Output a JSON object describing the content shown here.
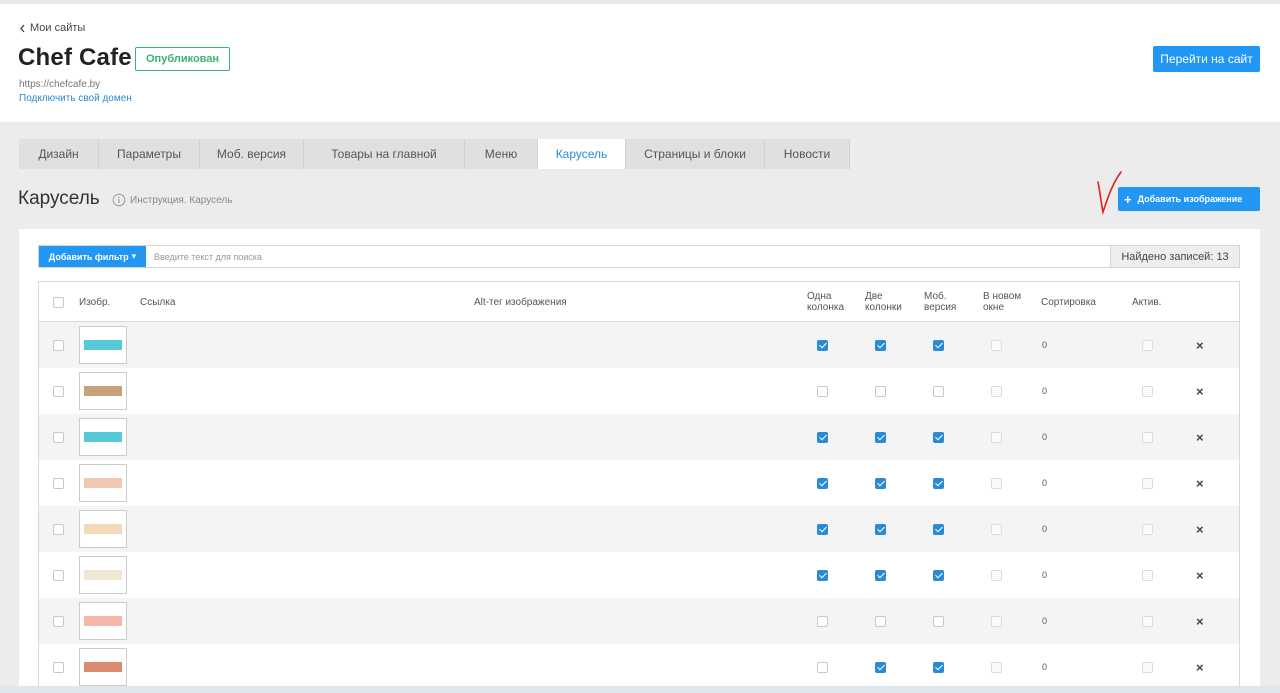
{
  "header": {
    "back_label": "Мои сайты",
    "site_title": "Chef Cafe",
    "status_badge": "Опубликован",
    "site_url": "https://chefcafe.by",
    "connect_domain": "Подключить свой домен",
    "goto_site": "Перейти на сайт"
  },
  "tabs": [
    {
      "label": "Дизайн"
    },
    {
      "label": "Параметры"
    },
    {
      "label": "Моб. версия"
    },
    {
      "label": "Товары на главной"
    },
    {
      "label": "Меню"
    },
    {
      "label": "Карусель"
    },
    {
      "label": "Страницы и блоки"
    },
    {
      "label": "Новости"
    }
  ],
  "section": {
    "title": "Карусель",
    "help_text": "Инструкция. Карусель",
    "add_image": "Добавить изображение"
  },
  "filter": {
    "add_filter": "Добавить фильтр",
    "search_placeholder": "Введите текст для поиска",
    "found": "Найдено записей: 13"
  },
  "columns": {
    "image": "Изобр.",
    "link": "Ссылка",
    "alt": "Alt-тег изображения",
    "one_col_1": "Одна",
    "one_col_2": "колонка",
    "two_col_1": "Две",
    "two_col_2": "колонки",
    "mob_1": "Моб.",
    "mob_2": "версия",
    "new_win_1": "В новом",
    "new_win_2": "окне",
    "sort": "Сортировка",
    "active": "Актив."
  },
  "rows": [
    {
      "thumb_color": "#56c8d8",
      "one_col": true,
      "two_col": true,
      "mob": true,
      "sort": "0"
    },
    {
      "thumb_color": "#c8a07a",
      "one_col": false,
      "two_col": false,
      "mob": false,
      "sort": "0"
    },
    {
      "thumb_color": "#56c8d8",
      "one_col": true,
      "two_col": true,
      "mob": true,
      "sort": "0"
    },
    {
      "thumb_color": "#f2c7b0",
      "one_col": true,
      "two_col": true,
      "mob": true,
      "sort": "0"
    },
    {
      "thumb_color": "#f3d9b8",
      "one_col": true,
      "two_col": true,
      "mob": true,
      "sort": "0"
    },
    {
      "thumb_color": "#efe6d4",
      "one_col": true,
      "two_col": true,
      "mob": true,
      "sort": "0"
    },
    {
      "thumb_color": "#f4b6a8",
      "one_col": false,
      "two_col": false,
      "mob": false,
      "sort": "0"
    },
    {
      "thumb_color": "#d98a70",
      "one_col": false,
      "two_col": true,
      "mob": true,
      "sort": "0"
    }
  ],
  "colors": {
    "accent": "#2196f3",
    "published": "#3cb371"
  }
}
